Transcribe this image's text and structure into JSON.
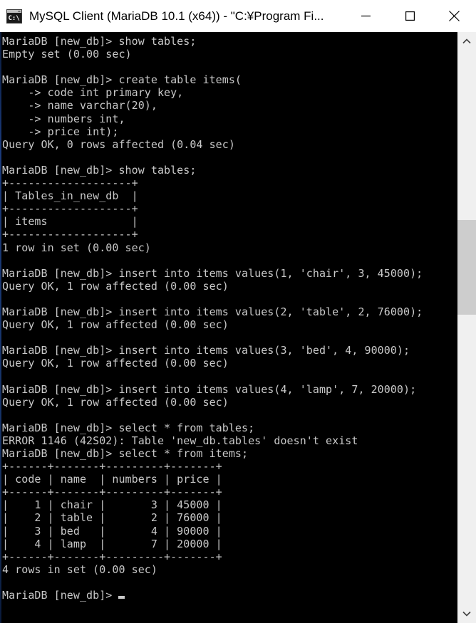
{
  "window": {
    "title": "MySQL Client (MariaDB 10.1 (x64)) - \"C:¥Program Fi...",
    "icon": "console-icon",
    "controls": {
      "minimize_label": "—",
      "maximize_label": "□",
      "close_label": "✕"
    },
    "titlebar_bg": "#ffffff",
    "titlebar_fg": "#000000"
  },
  "terminal": {
    "bg": "#000000",
    "fg": "#c8c8c8",
    "prompt": "MariaDB [new_db]>",
    "cursor": "block-underscore",
    "lines": [
      "MariaDB [new_db]> show tables;",
      "Empty set (0.00 sec)",
      "",
      "MariaDB [new_db]> create table items(",
      "    -> code int primary key,",
      "    -> name varchar(20),",
      "    -> numbers int,",
      "    -> price int);",
      "Query OK, 0 rows affected (0.04 sec)",
      "",
      "MariaDB [new_db]> show tables;",
      "+-------------------+",
      "| Tables_in_new_db  |",
      "+-------------------+",
      "| items             |",
      "+-------------------+",
      "1 row in set (0.00 sec)",
      "",
      "MariaDB [new_db]> insert into items values(1, 'chair', 3, 45000);",
      "Query OK, 1 row affected (0.00 sec)",
      "",
      "MariaDB [new_db]> insert into items values(2, 'table', 2, 76000);",
      "Query OK, 1 row affected (0.00 sec)",
      "",
      "MariaDB [new_db]> insert into items values(3, 'bed', 4, 90000);",
      "Query OK, 1 row affected (0.00 sec)",
      "",
      "MariaDB [new_db]> insert into items values(4, 'lamp', 7, 20000);",
      "Query OK, 1 row affected (0.00 sec)",
      "",
      "MariaDB [new_db]> select * from tables;",
      "ERROR 1146 (42S02): Table 'new_db.tables' doesn't exist",
      "MariaDB [new_db]> select * from items;",
      "+------+-------+---------+-------+",
      "| code | name  | numbers | price |",
      "+------+-------+---------+-------+",
      "|    1 | chair |       3 | 45000 |",
      "|    2 | table |       2 | 76000 |",
      "|    3 | bed   |       4 | 90000 |",
      "|    4 | lamp  |       7 | 20000 |",
      "+------+-------+---------+-------+",
      "4 rows in set (0.00 sec)",
      ""
    ],
    "last_prompt": "MariaDB [new_db]> ",
    "result_table": {
      "columns": [
        "code",
        "name",
        "numbers",
        "price"
      ],
      "rows": [
        [
          "1",
          "chair",
          "3",
          "45000"
        ],
        [
          "2",
          "table",
          "2",
          "76000"
        ],
        [
          "3",
          "bed",
          "4",
          "90000"
        ],
        [
          "4",
          "lamp",
          "7",
          "20000"
        ]
      ],
      "row_count_text": "4 rows in set (0.00 sec)"
    },
    "tables_listing": {
      "column": "Tables_in_new_db",
      "rows": [
        "items"
      ],
      "row_count_text": "1 row in set (0.00 sec)"
    },
    "error_text": "ERROR 1146 (42S02): Table 'new_db.tables' doesn't exist"
  },
  "scrollbar": {
    "up_arrow": "chevron-up-icon",
    "down_arrow": "chevron-down-icon",
    "track_color": "#f0f0f0",
    "thumb_color": "#cdcdcd"
  }
}
